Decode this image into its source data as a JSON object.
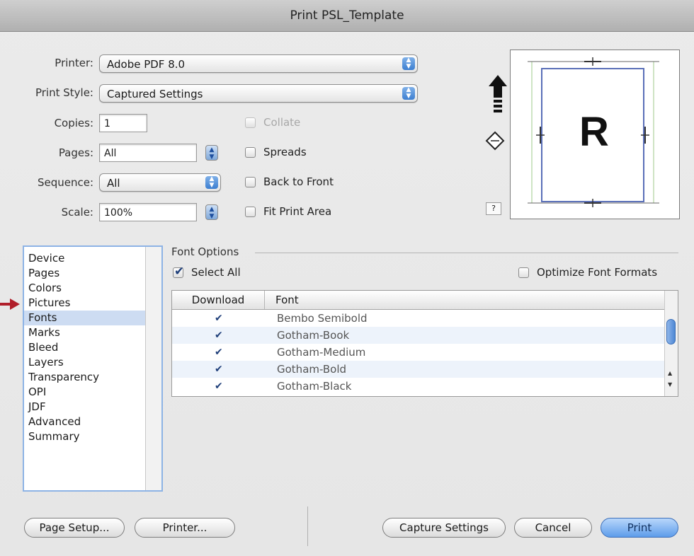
{
  "window": {
    "title": "Print PSL_Template"
  },
  "form": {
    "printer_label": "Printer:",
    "printer_value": "Adobe PDF 8.0",
    "print_style_label": "Print Style:",
    "print_style_value": "Captured Settings",
    "copies_label": "Copies:",
    "copies_value": "1",
    "pages_label": "Pages:",
    "pages_value": "All",
    "sequence_label": "Sequence:",
    "sequence_value": "All",
    "scale_label": "Scale:",
    "scale_value": "100%"
  },
  "options": {
    "collate": {
      "label": "Collate",
      "checked": false,
      "disabled": true
    },
    "spreads": {
      "label": "Spreads",
      "checked": false
    },
    "back_to_front": {
      "label": "Back to Front",
      "checked": false
    },
    "fit_print_area": {
      "label": "Fit Print Area",
      "checked": false
    }
  },
  "preview": {
    "letter": "R",
    "help": "?"
  },
  "sidebar": {
    "items": [
      {
        "label": "Device"
      },
      {
        "label": "Pages"
      },
      {
        "label": "Colors"
      },
      {
        "label": "Pictures"
      },
      {
        "label": "Fonts",
        "selected": true
      },
      {
        "label": "Marks"
      },
      {
        "label": "Bleed"
      },
      {
        "label": "Layers"
      },
      {
        "label": "Transparency"
      },
      {
        "label": "OPI"
      },
      {
        "label": "JDF"
      },
      {
        "label": "Advanced"
      },
      {
        "label": "Summary"
      }
    ]
  },
  "font_options": {
    "group_title": "Font Options",
    "select_all_label": "Select All",
    "select_all_checked": true,
    "optimize_label": "Optimize Font Formats",
    "optimize_checked": false,
    "columns": [
      "Download",
      "Font"
    ],
    "rows": [
      {
        "download": true,
        "font": "Bembo Semibold"
      },
      {
        "download": true,
        "font": "Gotham-Book"
      },
      {
        "download": true,
        "font": "Gotham-Medium"
      },
      {
        "download": true,
        "font": "Gotham-Bold"
      },
      {
        "download": true,
        "font": "Gotham-Black"
      }
    ]
  },
  "buttons": {
    "page_setup": "Page Setup...",
    "printer": "Printer...",
    "capture_settings": "Capture Settings",
    "cancel": "Cancel",
    "print": "Print"
  },
  "colors": {
    "accent": "#4d87d4",
    "selection": "#cddcf2",
    "callout_arrow": "#b01e2a"
  }
}
